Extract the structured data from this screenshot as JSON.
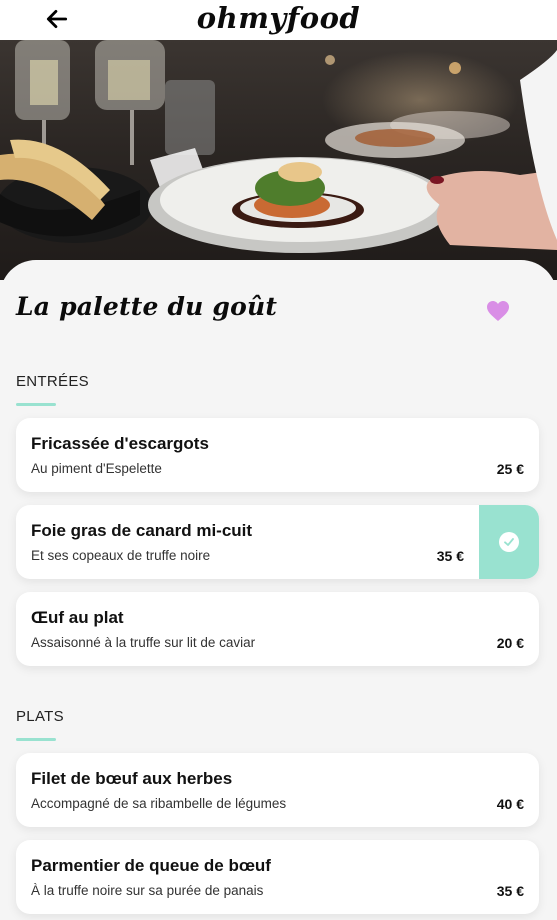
{
  "app": {
    "logo": "ohmyfood",
    "back_icon": "arrow-left-icon"
  },
  "restaurant": {
    "name": "La palette du goût",
    "favorite_icon": "heart-icon",
    "favorite_color": "#d98ee6"
  },
  "accent_color": "#99e2d0",
  "sections": [
    {
      "title": "ENTRÉES",
      "dishes": [
        {
          "name": "Fricassée d'escargots",
          "description": "Au piment d'Espelette",
          "price": "25 €",
          "selected": false
        },
        {
          "name": "Foie gras de canard mi-cuit",
          "description": "Et ses copeaux de truffe noire",
          "price": "35 €",
          "selected": true,
          "selected_icon": "check-icon"
        },
        {
          "name": "Œuf au plat",
          "description": "Assaisonné à la truffe sur lit de caviar",
          "price": "20 €",
          "selected": false
        }
      ]
    },
    {
      "title": "PLATS",
      "dishes": [
        {
          "name": "Filet de bœuf aux herbes",
          "description": "Accompagné de sa ribambelle de légumes",
          "price": "40 €",
          "selected": false
        },
        {
          "name": "Parmentier de queue de bœuf",
          "description": "À la truffe noire sur sa purée de panais",
          "price": "35 €",
          "selected": false
        }
      ]
    }
  ]
}
